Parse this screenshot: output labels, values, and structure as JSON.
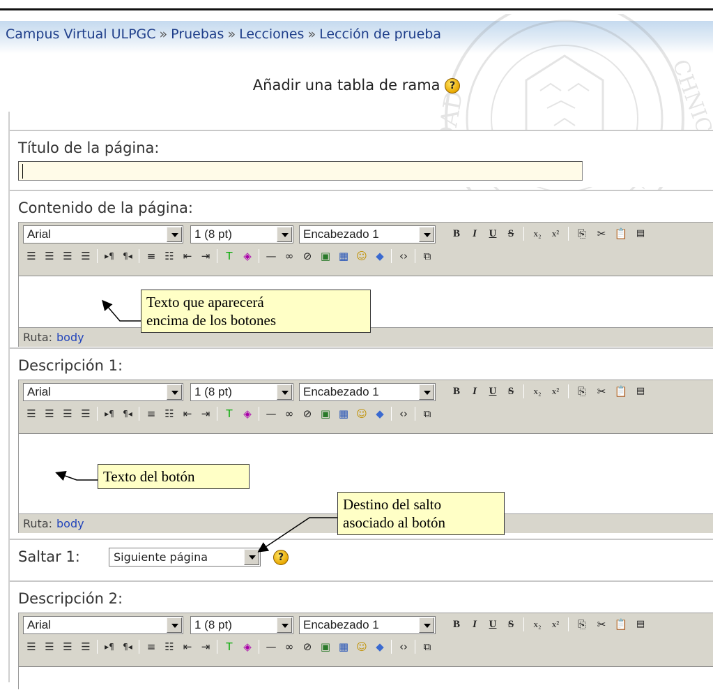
{
  "breadcrumb": {
    "items": [
      "Campus Virtual ULPGC",
      "Pruebas",
      "Lecciones",
      "Lección de prueba"
    ],
    "separator": "»"
  },
  "page": {
    "title": "Añadir una tabla de rama",
    "help_symbol": "?"
  },
  "fields": {
    "page_title_label": "Título de la página:",
    "page_title_value": "",
    "page_content_label": "Contenido de la página:",
    "description1_label": "Descripción 1:",
    "jump1_label": "Saltar 1:",
    "jump1_value": "Siguiente página",
    "description2_label": "Descripción 2:"
  },
  "editor": {
    "font_family": "Arial",
    "font_size": "1 (8 pt)",
    "heading": "Encabezado 1",
    "path_label": "Ruta:",
    "path_value": "body",
    "buttons_row1": [
      "B",
      "I",
      "U",
      "S",
      "x₂",
      "x²"
    ],
    "buttons_row2": [
      "align-left-icon",
      "align-center-icon",
      "align-right-icon",
      "justify-icon",
      "ltr-icon",
      "rtl-icon",
      "ordered-list-icon",
      "unordered-list-icon",
      "outdent-icon",
      "indent-icon",
      "text-color-icon",
      "bg-color-icon",
      "horizontal-rule-icon",
      "link-icon",
      "unlink-icon",
      "image-icon",
      "table-icon",
      "smiley-icon",
      "special-char-icon",
      "html-source-icon",
      "fullscreen-icon"
    ]
  },
  "callouts": {
    "content_note_line1": "Texto que aparecerá",
    "content_note_line2": "encima de los botones",
    "button_note": "Texto del botón",
    "jump_note_line1": "Destino del salto",
    "jump_note_line2": "asociado al botón"
  },
  "colors": {
    "breadcrumb_link": "#1e3e8a",
    "callout_bg": "#ffffc6",
    "toolbar_bg": "#d8d6cc",
    "input_bg": "#fffbe8",
    "path_link": "#2244bb"
  }
}
